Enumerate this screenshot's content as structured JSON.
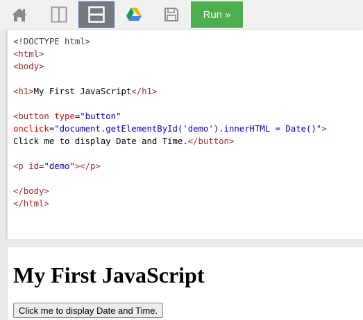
{
  "toolbar": {
    "buttons": [
      {
        "icon": "home-icon"
      },
      {
        "icon": "split-vertical-icon"
      },
      {
        "icon": "split-horizontal-icon",
        "active": true
      },
      {
        "icon": "google-drive-icon"
      },
      {
        "icon": "save-icon"
      }
    ],
    "run_label": "Run »",
    "run_color": "#4cae4c"
  },
  "editor": {
    "lines": [
      [
        {
          "t": "doc",
          "v": "<!DOCTYPE html>"
        }
      ],
      [
        {
          "t": "tag",
          "v": "<html>"
        }
      ],
      [
        {
          "t": "tag",
          "v": "<body>"
        }
      ],
      [],
      [
        {
          "t": "tag",
          "v": "<h1>"
        },
        {
          "t": "txt",
          "v": "My First JavaScript"
        },
        {
          "t": "tag",
          "v": "</h1>"
        }
      ],
      [],
      [
        {
          "t": "tag",
          "v": "<button "
        },
        {
          "t": "attr",
          "v": "type"
        },
        {
          "t": "txt",
          "v": "="
        },
        {
          "t": "val",
          "v": "\"button\""
        }
      ],
      [
        {
          "t": "attr",
          "v": "onclick"
        },
        {
          "t": "txt",
          "v": "="
        },
        {
          "t": "val",
          "v": "\"document.getElementById('demo').innerHTML = Date()\""
        },
        {
          "t": "tag",
          "v": ">"
        }
      ],
      [
        {
          "t": "txt",
          "v": "Click me to display Date and Time."
        },
        {
          "t": "tag",
          "v": "</button>"
        }
      ],
      [],
      [
        {
          "t": "tag",
          "v": "<p "
        },
        {
          "t": "attr",
          "v": "id"
        },
        {
          "t": "txt",
          "v": "="
        },
        {
          "t": "val",
          "v": "\"demo\""
        },
        {
          "t": "tag",
          "v": "></p>"
        }
      ],
      [],
      [
        {
          "t": "tag",
          "v": "</body>"
        }
      ],
      [
        {
          "t": "tag",
          "v": "</html>"
        }
      ]
    ]
  },
  "result": {
    "heading": "My First JavaScript",
    "button_label": "Click me to display Date and Time."
  }
}
